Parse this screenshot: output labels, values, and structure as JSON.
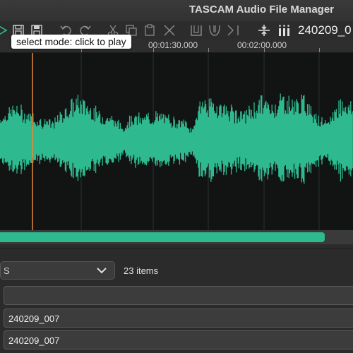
{
  "app": {
    "title": "TASCAM Audio File Manager"
  },
  "toolbar": {
    "filename": "240209_0",
    "tooltip": "select mode: click to play",
    "icons": [
      "play-icon",
      "save-icon",
      "save-as-icon",
      "undo-icon",
      "redo-icon",
      "cut-icon",
      "copy-icon",
      "paste-icon",
      "delete-icon",
      "fade-in-icon",
      "fade-out-icon",
      "marker-icon",
      "split-icon",
      "meter-icon"
    ]
  },
  "ruler": {
    "labels": [
      "00:01:30.000",
      "00:02:00.000"
    ]
  },
  "playback": {
    "progress_fraction": 0.92
  },
  "colors": {
    "waveform": "#2fb98e",
    "playhead": "#e8893a",
    "background": "#121414"
  },
  "list": {
    "filter_value": "S",
    "item_count": "23 items",
    "rows": [
      "",
      "240209_007",
      "240209_007"
    ]
  }
}
